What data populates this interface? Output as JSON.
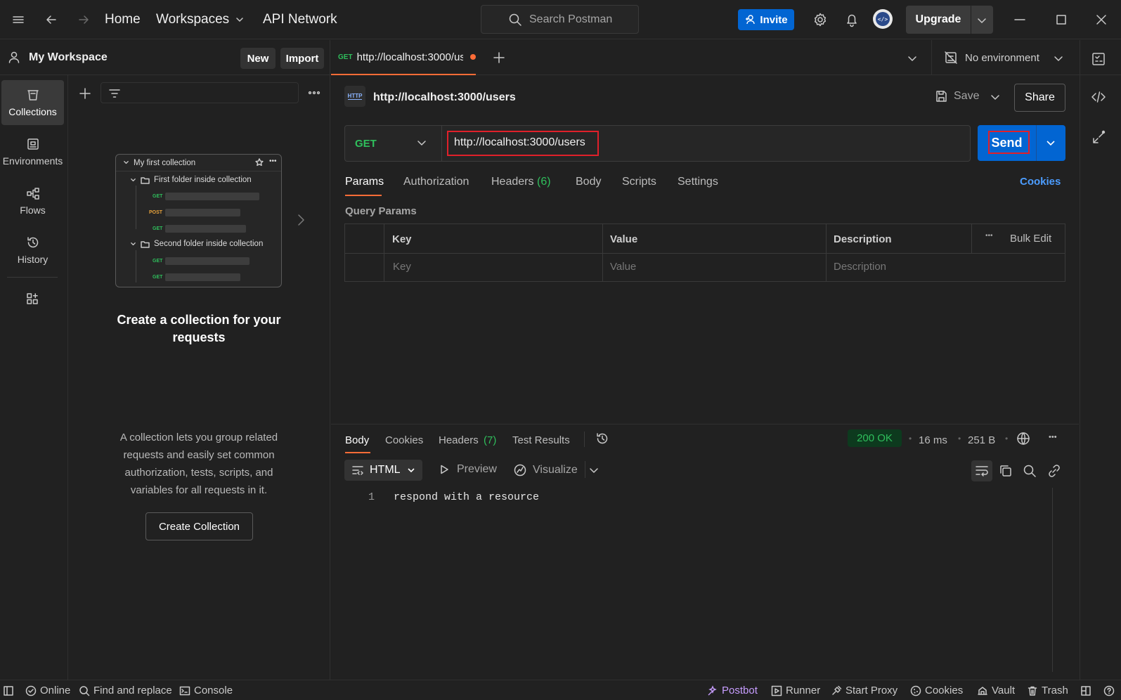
{
  "topbar": {
    "nav": {
      "home": "Home",
      "workspaces": "Workspaces",
      "api_network": "API Network"
    },
    "search_placeholder": "Search Postman",
    "invite_label": "Invite",
    "upgrade_label": "Upgrade"
  },
  "workspace": {
    "name": "My Workspace",
    "new_label": "New",
    "import_label": "Import"
  },
  "rail": {
    "items": [
      {
        "label": "Collections",
        "icon": "collections-icon",
        "active": true
      },
      {
        "label": "Environments",
        "icon": "environments-icon"
      },
      {
        "label": "Flows",
        "icon": "flows-icon"
      },
      {
        "label": "History",
        "icon": "history-icon"
      }
    ]
  },
  "empty_state": {
    "illustration": {
      "collection": "My first collection",
      "folder1": "First folder inside collection",
      "folder2": "Second folder inside collection",
      "methods": [
        "GET",
        "POST",
        "GET",
        "GET",
        "GET"
      ]
    },
    "title": "Create a collection for your requests",
    "body": "A collection lets you group related requests and easily set common authorization, tests, scripts, and variables for all requests in it.",
    "button": "Create Collection"
  },
  "tabs": {
    "active": {
      "method": "GET",
      "title": "http://localhost:3000/us"
    },
    "environment": "No environment"
  },
  "request": {
    "name": "http://localhost:3000/users",
    "save_label": "Save",
    "share_label": "Share",
    "method": "GET",
    "url": "http://localhost:3000/users",
    "send_label": "Send",
    "subtabs": {
      "params": "Params",
      "authorization": "Authorization",
      "headers": "Headers",
      "headers_count": "(6)",
      "body": "Body",
      "scripts": "Scripts",
      "settings": "Settings"
    },
    "cookies_label": "Cookies",
    "query_params_title": "Query Params",
    "table": {
      "headers": [
        "Key",
        "Value",
        "Description"
      ],
      "bulk_edit": "Bulk Edit",
      "placeholders": [
        "Key",
        "Value",
        "Description"
      ]
    }
  },
  "response": {
    "tabs": {
      "body": "Body",
      "cookies": "Cookies",
      "headers": "Headers",
      "headers_count": "(7)",
      "test_results": "Test Results"
    },
    "status": "200 OK",
    "time": "16 ms",
    "size": "251 B",
    "format": "HTML",
    "preview_label": "Preview",
    "visualize_label": "Visualize",
    "line_number": "1",
    "line_text": "respond with a resource"
  },
  "statusbar": {
    "online": "Online",
    "find_replace": "Find and replace",
    "console": "Console",
    "postbot": "Postbot",
    "runner": "Runner",
    "start_proxy": "Start Proxy",
    "cookies": "Cookies",
    "vault": "Vault",
    "trash": "Trash"
  },
  "colors": {
    "accent_blue": "#0265d2",
    "orange": "#ff6c37",
    "get_green": "#2fbf5c",
    "post_orange": "#e6a23c",
    "highlight_red": "#e0202a"
  }
}
